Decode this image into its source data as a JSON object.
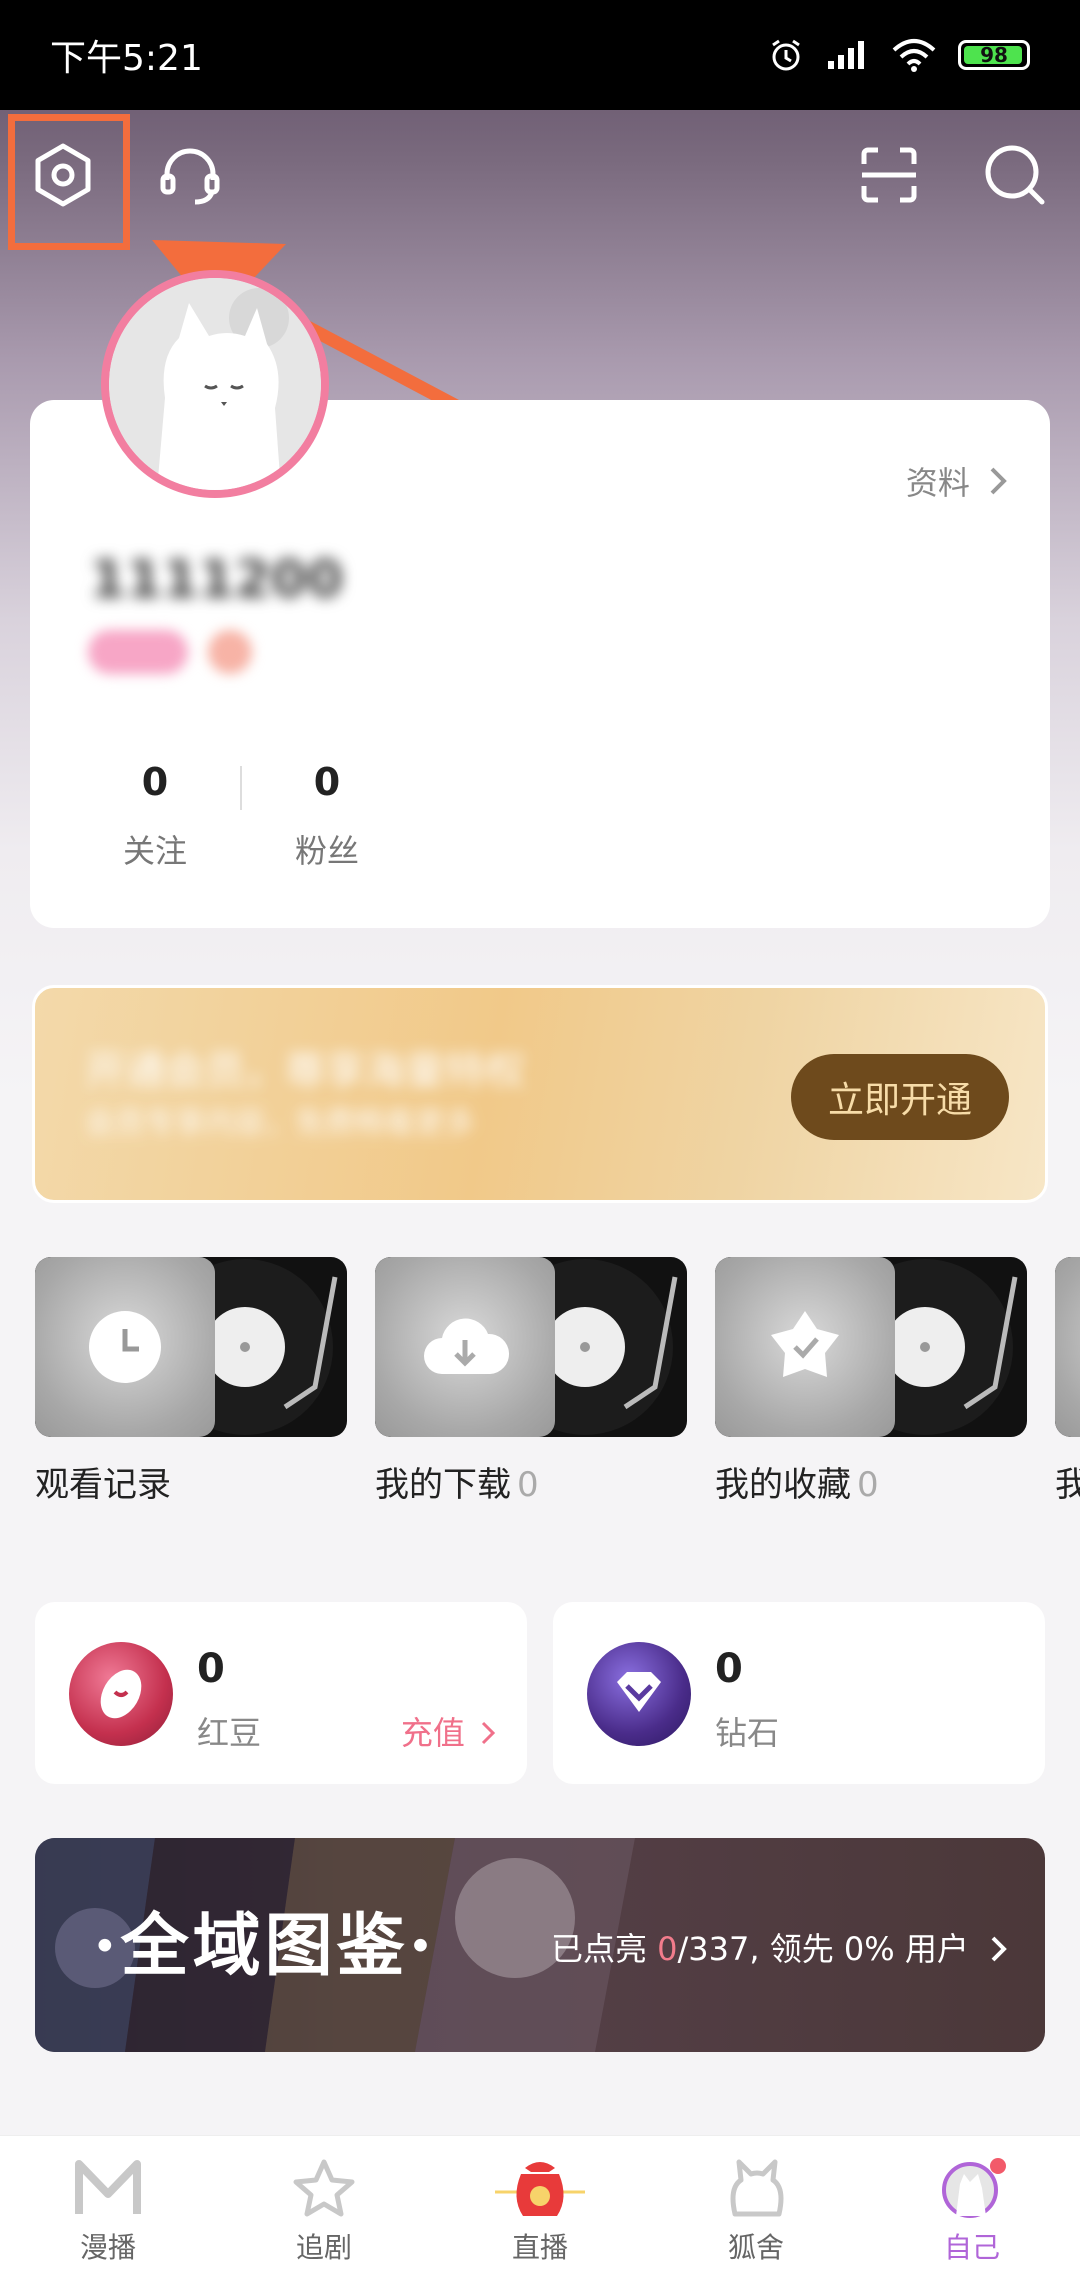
{
  "status_bar": {
    "time": "下午5:21",
    "battery": "98"
  },
  "profile": {
    "detail_link": "资料",
    "username": "1111200",
    "stats": [
      {
        "value": "0",
        "label": "关注"
      },
      {
        "value": "0",
        "label": "粉丝"
      }
    ]
  },
  "vip_banner": {
    "headline": "开通会员，尊享海量特权",
    "subline": "会员专享内容，免费畅看更多",
    "button_label": "立即开通"
  },
  "shortcuts": [
    {
      "label": "观看记录",
      "count": ""
    },
    {
      "label": "我的下载",
      "count": "0"
    },
    {
      "label": "我的收藏",
      "count": "0"
    },
    {
      "label": "我",
      "count": ""
    }
  ],
  "wallet": {
    "red_beans": {
      "value": "0",
      "label": "红豆",
      "action": "充值"
    },
    "diamonds": {
      "value": "0",
      "label": "钻石"
    }
  },
  "codex": {
    "title": "·全域图鉴·",
    "prefix": "已点亮 ",
    "lit": "0",
    "suffix": "/337, 领先 0% 用户"
  },
  "bottom_nav": [
    {
      "label": "漫播"
    },
    {
      "label": "追剧"
    },
    {
      "label": "直播"
    },
    {
      "label": "狐舍"
    },
    {
      "label": "自己"
    }
  ],
  "colors": {
    "accent_pink": "#f27ea0",
    "annotation_orange": "#f36d3d",
    "vip_button": "#6e4a1c",
    "active_tab": "#b065d8"
  }
}
